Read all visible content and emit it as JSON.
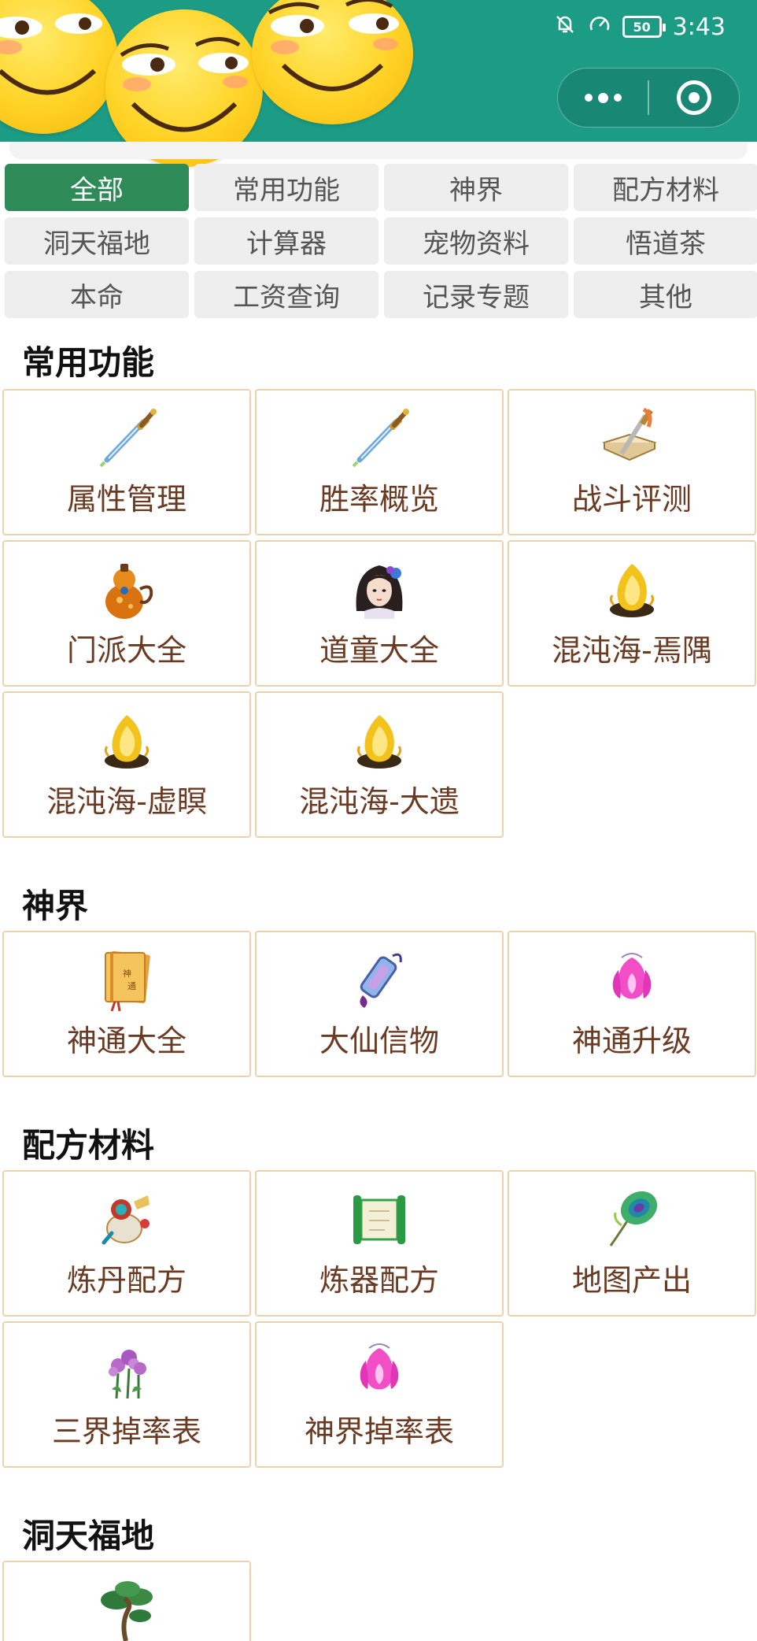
{
  "status_bar": {
    "battery": "50",
    "time": "3:43"
  },
  "categories": [
    {
      "label": "全部",
      "active": true
    },
    {
      "label": "常用功能"
    },
    {
      "label": "神界"
    },
    {
      "label": "配方材料"
    },
    {
      "label": "洞天福地"
    },
    {
      "label": "计算器"
    },
    {
      "label": "宠物资料"
    },
    {
      "label": "悟道茶"
    },
    {
      "label": "本命"
    },
    {
      "label": "工资查询"
    },
    {
      "label": "记录专题"
    },
    {
      "label": "其他"
    }
  ],
  "sections": [
    {
      "title": "常用功能",
      "items": [
        {
          "label": "属性管理",
          "icon": "sword-icon"
        },
        {
          "label": "胜率概览",
          "icon": "sword-icon"
        },
        {
          "label": "战斗评测",
          "icon": "book-sword-icon"
        },
        {
          "label": "门派大全",
          "icon": "gourd-icon"
        },
        {
          "label": "道童大全",
          "icon": "maiden-portrait-icon"
        },
        {
          "label": "混沌海-焉隅",
          "icon": "golden-flame-icon"
        },
        {
          "label": "混沌海-虚瞑",
          "icon": "golden-flame-icon"
        },
        {
          "label": "混沌海-大遗",
          "icon": "golden-flame-icon"
        }
      ]
    },
    {
      "title": "神界",
      "items": [
        {
          "label": "神通大全",
          "icon": "golden-book-icon"
        },
        {
          "label": "大仙信物",
          "icon": "jade-token-icon"
        },
        {
          "label": "神通升级",
          "icon": "pink-flame-icon"
        }
      ]
    },
    {
      "title": "配方材料",
      "items": [
        {
          "label": "炼丹配方",
          "icon": "alchemy-gourd-icon"
        },
        {
          "label": "炼器配方",
          "icon": "green-scroll-icon"
        },
        {
          "label": "地图产出",
          "icon": "peacock-feather-icon"
        },
        {
          "label": "三界掉率表",
          "icon": "lilac-flower-icon"
        },
        {
          "label": "神界掉率表",
          "icon": "pink-flame-icon"
        }
      ]
    },
    {
      "title": "洞天福地",
      "items": [
        {
          "label": "",
          "icon": "bonsai-tree-icon"
        }
      ]
    }
  ]
}
